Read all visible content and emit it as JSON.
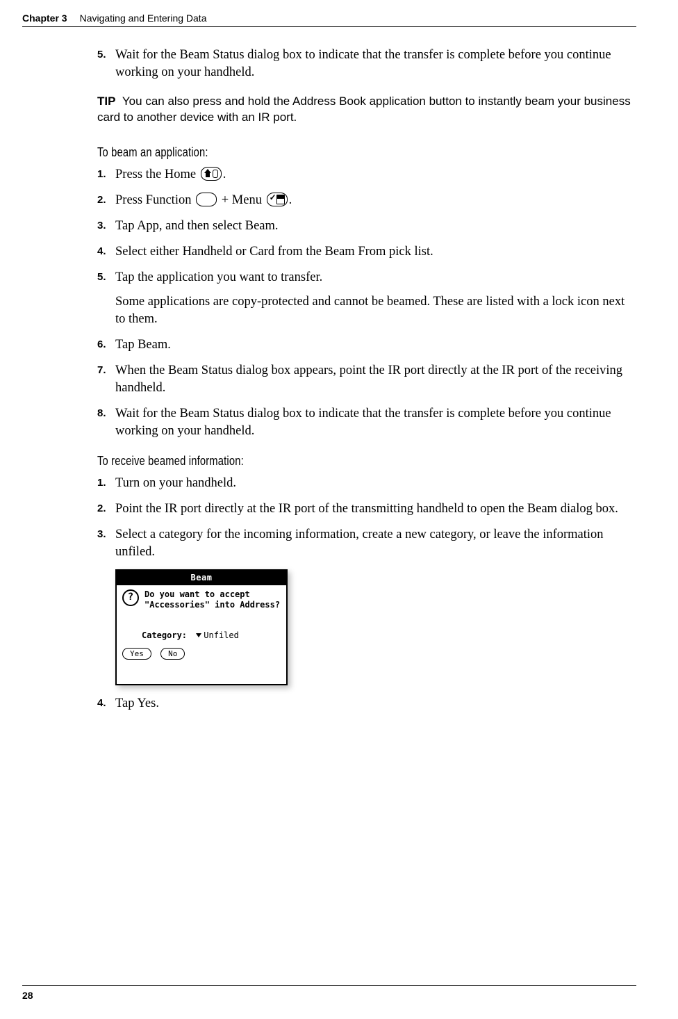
{
  "header": {
    "chapter": "Chapter 3",
    "title": "Navigating and Entering Data"
  },
  "steps_continue": {
    "n5": "5.",
    "t5": "Wait for the Beam Status dialog box to indicate that the transfer is complete before you continue working on your handheld."
  },
  "tip": {
    "label": "TIP",
    "text": "You can also press and hold the Address Book application button to instantly beam your business card to another device with an IR port."
  },
  "section_app": {
    "heading": "To beam an application:",
    "n1": "1.",
    "t1a": "Press the Home ",
    "t1b": ".",
    "n2": "2.",
    "t2a": "Press Function ",
    "t2b": " + Menu ",
    "t2c": ".",
    "n3": "3.",
    "t3": "Tap App, and then select Beam.",
    "n4": "4.",
    "t4": "Select either Handheld or Card from the Beam From pick list.",
    "n5": "5.",
    "t5": "Tap the application you want to transfer.",
    "t5_sub": "Some applications are copy-protected and cannot be beamed. These are listed with a lock icon next to them.",
    "n6": "6.",
    "t6": "Tap Beam.",
    "n7": "7.",
    "t7": "When the Beam Status dialog box appears, point the IR port directly at the IR port of the receiving handheld.",
    "n8": "8.",
    "t8": "Wait for the Beam Status dialog box to indicate that the transfer is complete before you continue working on your handheld."
  },
  "section_rx": {
    "heading": "To receive beamed information:",
    "n1": "1.",
    "t1": "Turn on your handheld.",
    "n2": "2.",
    "t2": "Point the IR port directly at the IR port of the transmitting handheld to open the Beam dialog box.",
    "n3": "3.",
    "t3": "Select a category for the incoming information, create a new category, or leave the information unfiled.",
    "n4": "4.",
    "t4": "Tap Yes."
  },
  "dialog": {
    "title": "Beam",
    "question_mark": "?",
    "message": "Do you want to accept \"Accessories\" into Address?",
    "category_label": "Category:",
    "category_value": "Unfiled",
    "yes": "Yes",
    "no": "No"
  },
  "footer": {
    "page": "28"
  }
}
